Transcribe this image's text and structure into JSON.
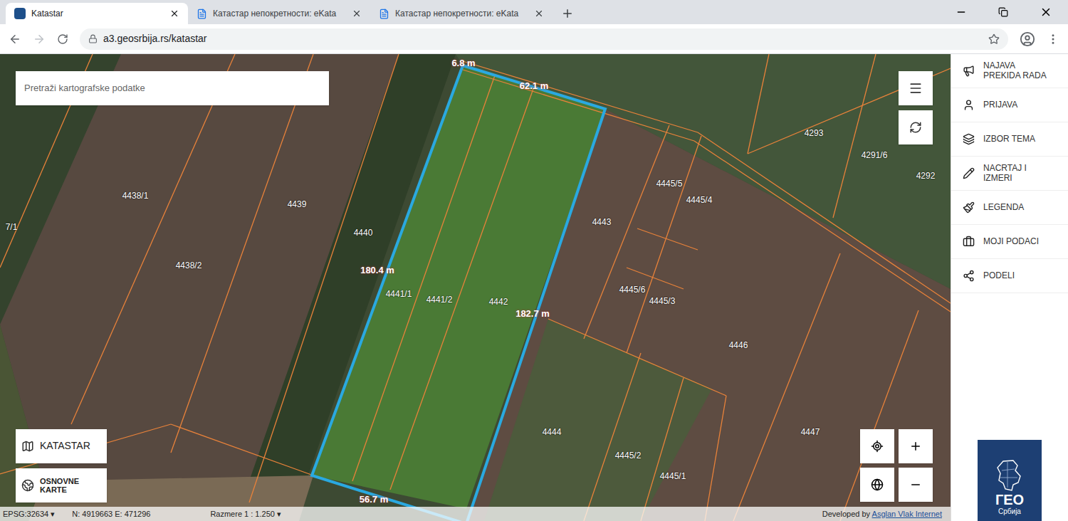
{
  "browser": {
    "tabs": [
      {
        "title": "Katastar",
        "selected": true
      },
      {
        "title": "Катастар непокретности: eKata",
        "selected": false
      },
      {
        "title": "Катастар непокретности: eKata",
        "selected": false
      }
    ],
    "url": "a3.geosrbija.rs/katastar"
  },
  "search": {
    "placeholder": "Pretraži kartografske podatke"
  },
  "map": {
    "parcels": [
      "4438/1",
      "4438/2",
      "4439",
      "4440",
      "4441/1",
      "4441/2",
      "4442",
      "4443",
      "4445/5",
      "4445/4",
      "4445/6",
      "4445/3",
      "4446",
      "4444",
      "4445/2",
      "4445/1",
      "4447",
      "4293",
      "4291/6",
      "4292",
      "7/1"
    ],
    "measurements": [
      "6.8 m",
      "62.1 m",
      "180.4 m",
      "182.7 m",
      "56.7 m"
    ],
    "layer_buttons": [
      "KATASTAR",
      "OSNOVNE KARTE"
    ]
  },
  "status_bar": {
    "crs": "EPSG:32634 ▾",
    "coordinates": "N: 4919663 E: 471296",
    "scale": "Razmere 1 : 1.250 ▾",
    "credit": "Developed by",
    "credit_link": "Asglan Vlak Internet"
  },
  "sidebar": {
    "items": [
      "NAJAVA PREKIDA RADA",
      "PRIJAVA",
      "IZBOR TEMA",
      "NACRTAJ I IZMERI",
      "LEGENDA",
      "MOJI PODACI",
      "PODELI"
    ]
  },
  "logo": {
    "title": "ГЕО",
    "subtitle": "Србија"
  }
}
